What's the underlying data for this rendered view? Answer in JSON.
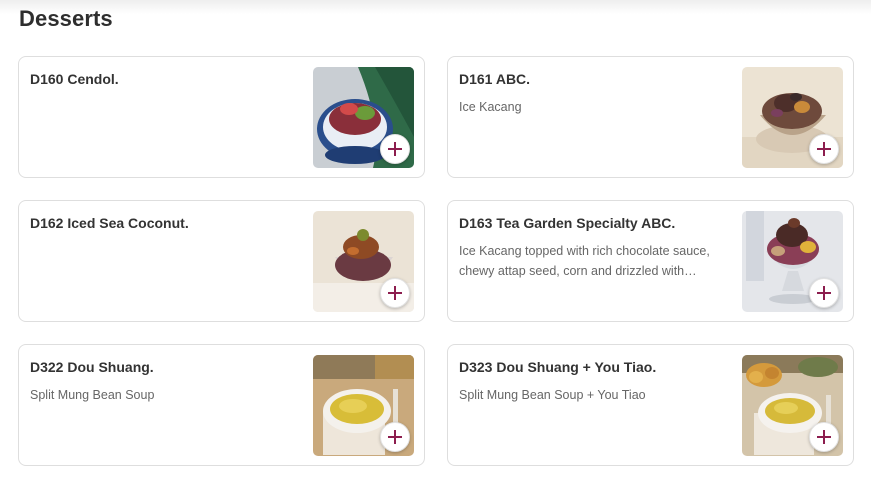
{
  "section": {
    "title": "Desserts"
  },
  "theme": {
    "accent": "#8c1d4e"
  },
  "items": [
    {
      "name": "D160 Cendol.",
      "description": "",
      "image_icon": "cendol-photo-icon"
    },
    {
      "name": "D161 ABC.",
      "description": "Ice Kacang",
      "image_icon": "abc-photo-icon"
    },
    {
      "name": "D162 Iced Sea Coconut.",
      "description": "",
      "image_icon": "sea-coconut-photo-icon"
    },
    {
      "name": "D163 Tea Garden Specialty ABC.",
      "description": "Ice Kacang topped with rich chocolate sauce, chewy attap seed, corn and drizzled with condensed milk",
      "image_icon": "specialty-abc-photo-icon"
    },
    {
      "name": "D322 Dou Shuang.",
      "description": "Split Mung Bean Soup",
      "image_icon": "dou-shuang-photo-icon"
    },
    {
      "name": "D323 Dou Shuang + You Tiao.",
      "description": "Split Mung Bean Soup + You Tiao",
      "image_icon": "dou-shuang-you-tiao-photo-icon"
    }
  ]
}
